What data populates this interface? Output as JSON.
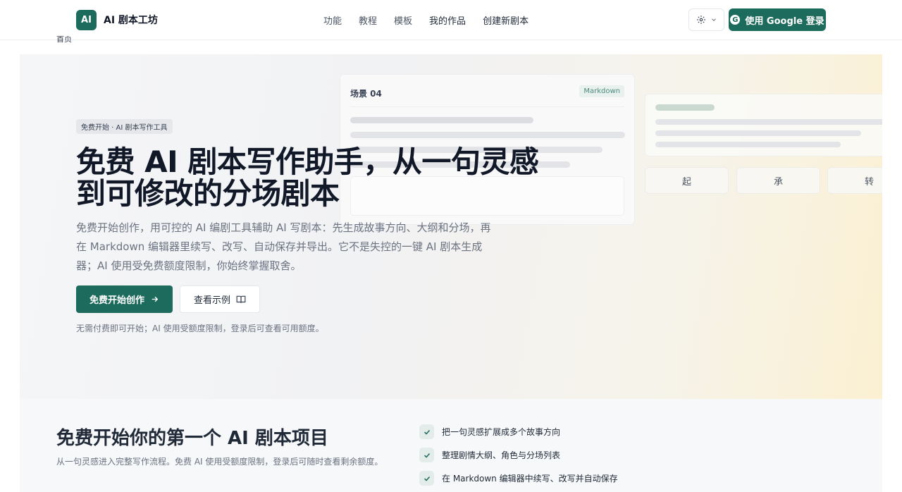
{
  "header": {
    "logo_mark": "AI",
    "app_name": "AI 剧本工坊",
    "nav": [
      {
        "label": "功能"
      },
      {
        "label": "教程"
      },
      {
        "label": "模板"
      },
      {
        "label": "我的作品"
      },
      {
        "label": "创建新剧本"
      }
    ],
    "login_label": "使用 Google 登录",
    "google_glyph": "G"
  },
  "breadcrumb": "首页",
  "hero": {
    "tag": "免费开始 · AI 剧本写作工具",
    "title_line1": "免费 AI 剧本写作助手，从一句灵感",
    "title_line2": "到可修改的分场剧本",
    "description": "免费开始创作，用可控的 AI 编剧工具辅助 AI 写剧本：先生成故事方向、大纲和分场，再在 Markdown 编辑器里续写、改写、自动保存并导出。它不是失控的一键 AI 剧本生成器；AI 使用受免费额度限制，你始终掌握取舍。",
    "primary_label": "免费开始创作",
    "secondary_label": "查看示例",
    "note": "无需付费即可开始；AI 使用受额度限制，登录后可查看可用额度。",
    "preview": {
      "scene_title": "场景 04",
      "badge": "Markdown",
      "pills": [
        "起",
        "承",
        "转"
      ]
    }
  },
  "section": {
    "title": "免费开始你的第一个 AI 剧本项目",
    "subtitle": "从一句灵感进入完整写作流程。免费 AI 使用受额度限制，登录后可随时查看剩余额度。",
    "checklist": [
      "把一句灵感扩展成多个故事方向",
      "整理剧情大纲、角色与分场列表",
      "在 Markdown 编辑器中续写、改写并自动保存"
    ]
  },
  "colors": {
    "brand": "#1d6b5c",
    "hero_gradient_end": "#fbf0d2"
  },
  "icons": [
    "gear-icon",
    "chevron-down-icon",
    "google-icon",
    "arrow-right-icon",
    "book-open-icon",
    "check-icon"
  ]
}
